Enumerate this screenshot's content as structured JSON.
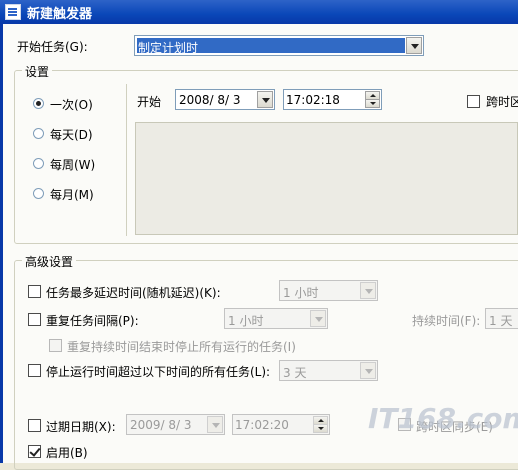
{
  "window": {
    "title": "新建触发器"
  },
  "start_task": {
    "label": "开始任务(G):",
    "selected": "制定计划时"
  },
  "settings": {
    "legend": "设置",
    "radios": [
      {
        "label": "一次(O)",
        "checked": true
      },
      {
        "label": "每天(D)",
        "checked": false
      },
      {
        "label": "每周(W)",
        "checked": false
      },
      {
        "label": "每月(M)",
        "checked": false
      }
    ],
    "start_label": "开始",
    "start_date": "2008/ 8/ 3",
    "start_time": "17:02:18",
    "cross_timezone": "跨时区"
  },
  "advanced": {
    "legend": "高级设置",
    "delay": {
      "label": "任务最多延迟时间(随机延迟)(K):",
      "value": "1 小时"
    },
    "repeat": {
      "label": "重复任务间隔(P):",
      "value": "1 小时",
      "duration_label": "持续时间(F):",
      "duration_value": "1 天"
    },
    "stop_running": {
      "label": "重复持续时间结束时停止所有运行的任务(I)"
    },
    "stop_over": {
      "label": "停止运行时间超过以下时间的所有任务(L):",
      "value": "3 天"
    },
    "expire": {
      "label": "过期日期(X):",
      "date": "2009/ 8/ 3",
      "time": "17:02:20",
      "sync_label": "跨时区同步(E)"
    },
    "enable": {
      "label": "启用(B)",
      "checked": true
    }
  },
  "watermark": "IT168.com"
}
